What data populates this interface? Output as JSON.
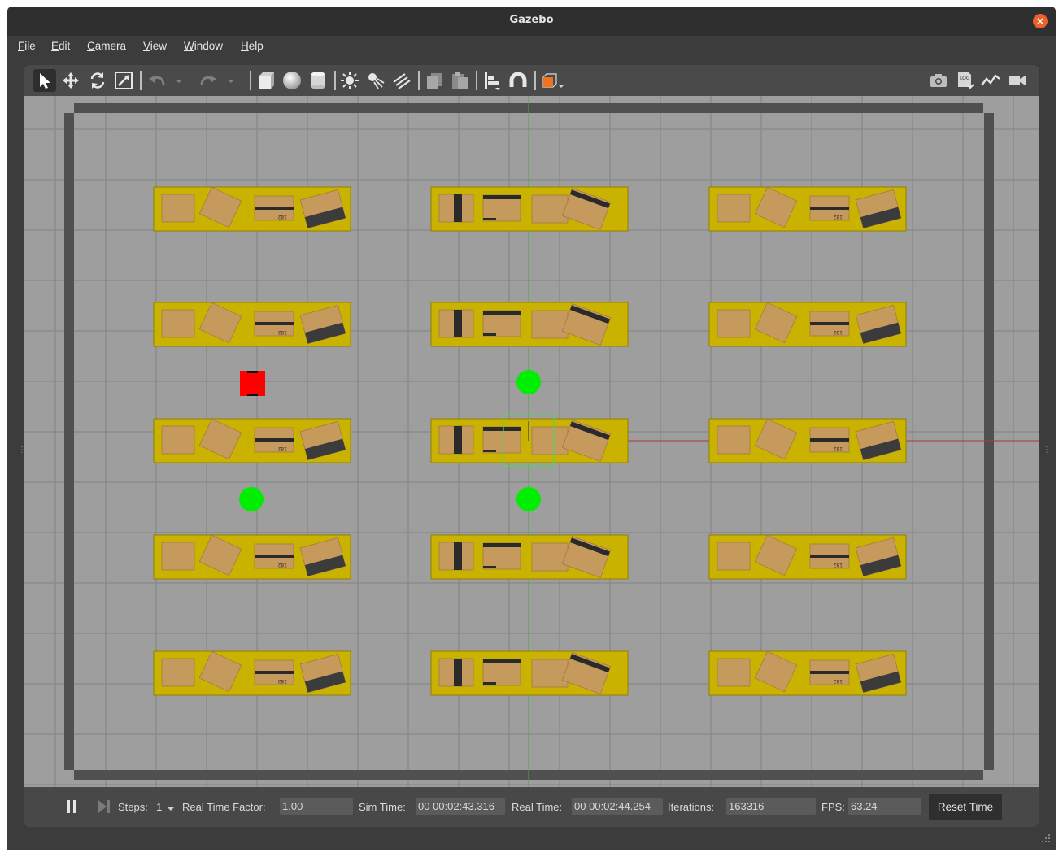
{
  "window": {
    "title": "Gazebo",
    "close_icon": "×"
  },
  "menu": [
    {
      "accel": "F",
      "rest": "ile"
    },
    {
      "accel": "E",
      "rest": "dit"
    },
    {
      "accel": "C",
      "rest": "amera"
    },
    {
      "accel": "V",
      "rest": "iew"
    },
    {
      "accel": "W",
      "rest": "indow"
    },
    {
      "accel": "H",
      "rest": "elp"
    }
  ],
  "toolbar": {
    "tools": [
      "select-arrow-icon",
      "translate-icon",
      "rotate-icon",
      "scale-icon",
      "undo-icon",
      "undo-dropdown-icon",
      "redo-icon",
      "redo-dropdown-icon",
      "box-shape-icon",
      "sphere-shape-icon",
      "cylinder-shape-icon",
      "point-light-icon",
      "spot-light-icon",
      "directional-light-icon",
      "copy-icon",
      "paste-icon",
      "align-icon",
      "snap-magnet-icon",
      "view-angle-cube-icon"
    ],
    "right_tools": [
      "screenshot-camera-icon",
      "log-icon",
      "plot-icon",
      "video-record-icon"
    ],
    "accent_color": "#f0731e"
  },
  "scene": {
    "ground_color": "#9e9e9e",
    "wall_color": "#505050",
    "shelf_color": "#c9b300",
    "box_color": "#c59a5c",
    "robot_color": "#ff0000",
    "marker_color": "#00ee00",
    "shelf_box_label": "182"
  },
  "bottom": {
    "steps_label": "Steps:",
    "steps_value": "1",
    "rtf_label": "Real Time Factor:",
    "rtf_value": "1.00",
    "sim_time_label": "Sim Time:",
    "sim_time_value": "00 00:02:43.316",
    "real_time_label": "Real Time:",
    "real_time_value": "00 00:02:44.254",
    "iterations_label": "Iterations:",
    "iterations_value": "163316",
    "fps_label": "FPS:",
    "fps_value": "63.24",
    "reset_label": "Reset Time"
  }
}
